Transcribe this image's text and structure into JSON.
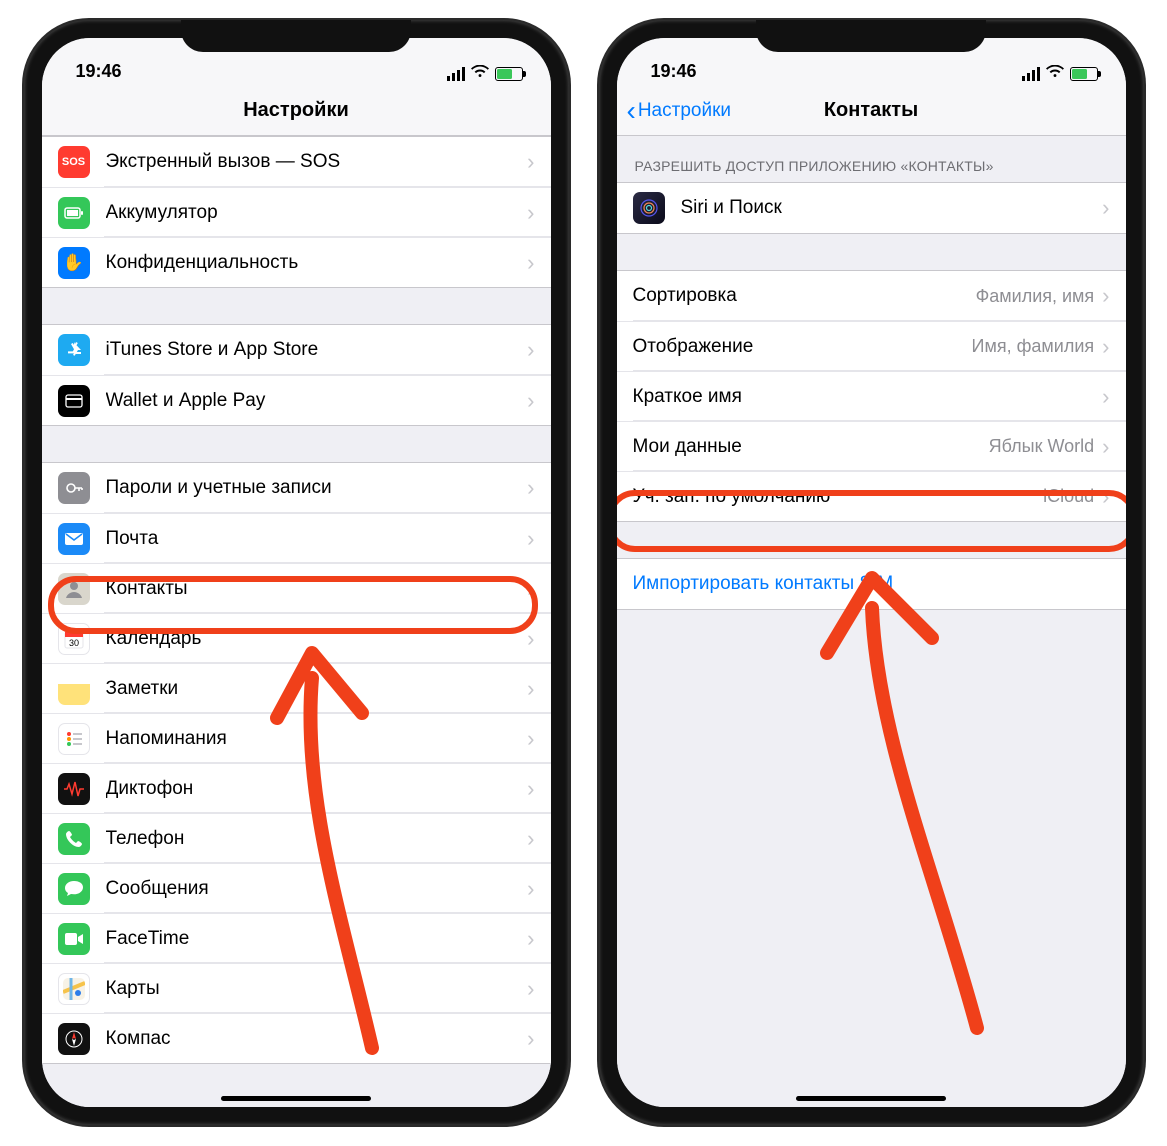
{
  "status": {
    "time": "19:46"
  },
  "left": {
    "title": "Настройки",
    "groups": [
      {
        "rows": [
          {
            "key": "sos",
            "label": "Экстренный вызов — SOS"
          },
          {
            "key": "battery",
            "label": "Аккумулятор"
          },
          {
            "key": "privacy",
            "label": "Конфиденциальность"
          }
        ]
      },
      {
        "rows": [
          {
            "key": "itunes",
            "label": "iTunes Store и App Store"
          },
          {
            "key": "wallet",
            "label": "Wallet и Apple Pay"
          }
        ]
      },
      {
        "rows": [
          {
            "key": "passwords",
            "label": "Пароли и учетные записи"
          },
          {
            "key": "mail",
            "label": "Почта"
          },
          {
            "key": "contacts",
            "label": "Контакты"
          },
          {
            "key": "calendar",
            "label": "Календарь"
          },
          {
            "key": "notes",
            "label": "Заметки"
          },
          {
            "key": "reminders",
            "label": "Напоминания"
          },
          {
            "key": "voice",
            "label": "Диктофон"
          },
          {
            "key": "phone",
            "label": "Телефон"
          },
          {
            "key": "messages",
            "label": "Сообщения"
          },
          {
            "key": "facetime",
            "label": "FaceTime"
          },
          {
            "key": "maps",
            "label": "Карты"
          },
          {
            "key": "compass",
            "label": "Компас"
          }
        ]
      }
    ]
  },
  "right": {
    "back": "Настройки",
    "title": "Контакты",
    "access_header": "РАЗРЕШИТЬ ДОСТУП ПРИЛОЖЕНИЮ «КОНТАКТЫ»",
    "siri": "Siri и Поиск",
    "settings": [
      {
        "key": "sort",
        "label": "Сортировка",
        "value": "Фамилия, имя"
      },
      {
        "key": "display",
        "label": "Отображение",
        "value": "Имя, фамилия"
      },
      {
        "key": "short",
        "label": "Краткое имя",
        "value": ""
      },
      {
        "key": "myinfo",
        "label": "Мои данные",
        "value": "Яблык World"
      },
      {
        "key": "default",
        "label": "Уч. зап. по умолчанию",
        "value": "iCloud"
      }
    ],
    "import_sim": "Импортировать контакты SIM"
  },
  "annotation_color": "#f0401a"
}
